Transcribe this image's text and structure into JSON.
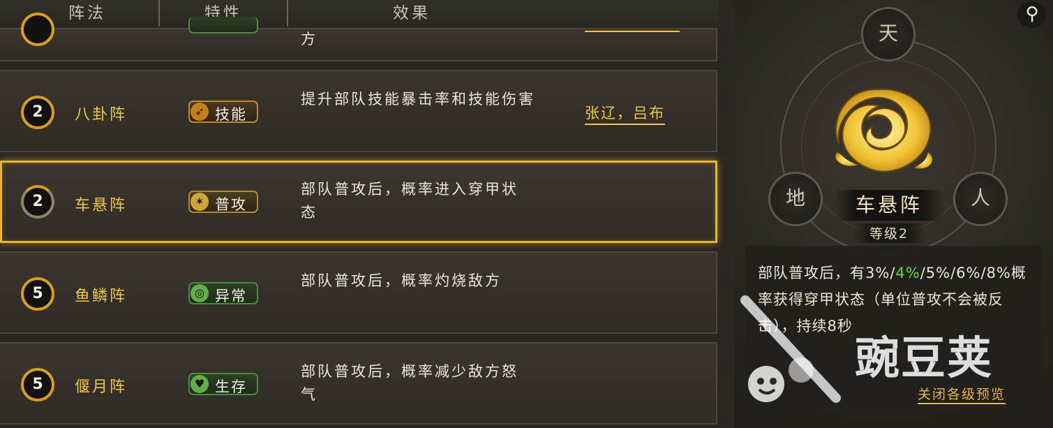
{
  "header": {
    "col_formation": "阵法",
    "col_trait": "特性",
    "col_effect": "效果"
  },
  "rows": [
    {
      "effect_tail": "方"
    },
    {
      "level": "2",
      "name": "八卦阵",
      "tag": "技能",
      "tag_icon": "blade-icon",
      "effect": "提升部队技能暴击率和技能伤害",
      "heroes": "张辽，吕布"
    },
    {
      "level": "2",
      "name": "车悬阵",
      "tag": "普攻",
      "tag_icon": "claw-icon",
      "effect": "部队普攻后，概率进入穿甲状态",
      "selected": true
    },
    {
      "level": "5",
      "name": "鱼鳞阵",
      "tag": "异常",
      "tag_icon": "swirl-icon",
      "effect": "部队普攻后，概率灼烧敌方"
    },
    {
      "level": "5",
      "name": "偃月阵",
      "tag": "生存",
      "tag_icon": "heart-icon",
      "effect": "部队普攻后，概率减少敌方怒气"
    }
  ],
  "detail": {
    "node_top": "天",
    "node_left": "地",
    "node_right": "人",
    "name": "车悬阵",
    "level": "等级2",
    "desc_pre": "部队普攻后，有3%/",
    "desc_hl": "4%",
    "desc_post": "/5%/6%/8%概率获得穿甲状态（单位普攻不会被反击），持续8秒",
    "close_link": "关闭各级预览"
  },
  "watermark": "豌豆荚",
  "colors": {
    "gold": "#f0c64a",
    "selected_border": "#e7b62d",
    "highlight_green": "#6bd24a"
  }
}
